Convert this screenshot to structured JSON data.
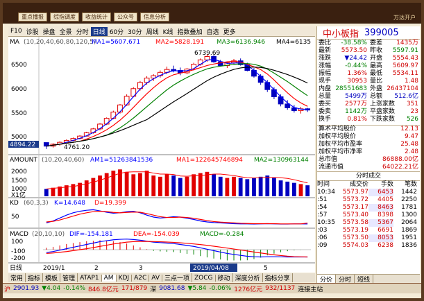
{
  "topbar": {
    "tabs": [
      "重点播报",
      "综指调度",
      "收益统计",
      "公众号",
      "信息分析"
    ],
    "right_text": "万达开户"
  },
  "toolbar": {
    "items": [
      "F10",
      "诊股",
      "操盘",
      "全景",
      "分时",
      "日线",
      "60分",
      "30分",
      "周线",
      "K线",
      "指数叠加",
      "自选",
      "更多"
    ],
    "selected": "日线"
  },
  "ma_legend": {
    "label": "MA",
    "params": "(10,20,40,60,80,120,5)",
    "ma1": "MA1=5607.671",
    "ma2": "MA2=5828.191",
    "ma3": "MA3=6136.946",
    "ma4": "MA4=6135"
  },
  "price_axis": [
    "6500",
    "6000",
    "5500",
    "5000"
  ],
  "price_labels": {
    "high": "6739.69",
    "low": "4761.20",
    "cur": "4894.22"
  },
  "amount_legend": {
    "label": "AMOUNT",
    "params": "(10,20,40,60)",
    "am1": "AM1=51263841536",
    "ma1": "MA1=122645746894",
    "ma2": "MA2=130963144"
  },
  "amount_axis": [
    "2000",
    "1500",
    "1000",
    "500"
  ],
  "amount_unit": "X1亿",
  "kd_legend": {
    "label": "KD",
    "params": "(60,3,3)",
    "k": "K=14.648",
    "d": "D=19.399"
  },
  "kd_axis": [
    "50"
  ],
  "macd_legend": {
    "label": "MACD",
    "params": "(20,10,10)",
    "dif": "DIF=-154.181",
    "dea": "DEA=-154.039",
    "macd": "MACD=-0.284"
  },
  "macd_axis": [
    "100",
    "-100",
    "-200"
  ],
  "date_axis": {
    "unit": "日线",
    "labels": [
      "2019/1",
      "2",
      "3",
      "2019/04/08",
      "5"
    ]
  },
  "bottom_tabs": [
    "常用",
    "指标",
    "模板",
    "管理",
    "ATAP1",
    "AM",
    "KDJ",
    "A2C",
    "AV",
    "三点一项",
    "ZOCG",
    "移动",
    "深度分析",
    "指标分享"
  ],
  "bottom_tab_selected": "AM",
  "status": {
    "items": [
      {
        "t": "沪",
        "c": "red"
      },
      {
        "t": "2901.93",
        "c": "blue"
      },
      {
        "t": "▼4.04",
        "c": "green"
      },
      {
        "t": "-0.14%",
        "c": "green"
      },
      {
        "t": "846.8亿元",
        "c": "red"
      },
      {
        "t": "171/879",
        "c": "red"
      },
      {
        "t": "深",
        "c": ""
      },
      {
        "t": "9081.68",
        "c": "blue"
      },
      {
        "t": "▼5.84",
        "c": "green"
      },
      {
        "t": "-0.06%",
        "c": "green"
      },
      {
        "t": "1276亿元",
        "c": "red"
      },
      {
        "t": "932/1137",
        "c": "red"
      },
      {
        "t": "连接主站",
        "c": ""
      }
    ]
  },
  "quote": {
    "name": "中小板指",
    "code": "399005",
    "rows": [
      [
        [
          "委比",
          "-38.58%",
          "green"
        ],
        [
          "委差",
          "1435万",
          "red"
        ]
      ],
      [
        [
          "最新",
          "5573.50",
          "red"
        ],
        [
          "昨收",
          "5597.91",
          "green"
        ]
      ],
      [
        [
          "涨跌",
          "▼24.42",
          "blue"
        ],
        [
          "开盘",
          "5554.43",
          "red"
        ]
      ],
      [
        [
          "涨幅",
          "-0.44%",
          "green"
        ],
        [
          "最高",
          "5609.97",
          "red"
        ]
      ],
      [
        [
          "振幅",
          "1.36%",
          "red"
        ],
        [
          "最低",
          "5534.11",
          "red"
        ]
      ],
      [
        [
          "现手",
          "30953",
          "red"
        ],
        [
          "量比",
          "1.48",
          "red"
        ]
      ],
      [
        [
          "内盘",
          "28551683",
          "green"
        ],
        [
          "外盘",
          "26437104",
          "red"
        ]
      ],
      [
        [
          "总量",
          "5499万",
          "blue"
        ],
        [
          "总额",
          "512.6亿",
          "blue"
        ]
      ],
      [
        [
          "委买",
          "2577万",
          "red"
        ],
        [
          "上涨家数",
          "351",
          "red"
        ]
      ],
      [
        [
          "委卖",
          "1142万",
          "green"
        ],
        [
          "平盘家数",
          "23",
          "red"
        ]
      ],
      [
        [
          "换手",
          "0.81%",
          "red"
        ],
        [
          "下跌家数",
          "526",
          "green"
        ]
      ]
    ],
    "stats": [
      [
        "算术平均股价",
        "12.13"
      ],
      [
        "加权平均股价",
        "9.47"
      ],
      [
        "加权平均市盈率",
        "25.48"
      ],
      [
        "加权平均市净率",
        "2.48"
      ],
      [
        "总市值",
        "86888.00亿"
      ],
      [
        "流通市值",
        "64022.21亿"
      ]
    ]
  },
  "trades": {
    "header": [
      "时间",
      "成交价",
      "手数",
      "笔数"
    ],
    "section_title": "分时成交",
    "rows": [
      [
        "10:34",
        "5573.97",
        "6453",
        "1442"
      ],
      [
        ":51",
        "5573.72",
        "4405",
        "2250"
      ],
      [
        ":54",
        "5573.17",
        "8463",
        "1781"
      ],
      [
        ":57",
        "5573.40",
        "8398",
        "1300"
      ],
      [
        "10:35",
        "5573.58",
        "5367",
        "2064"
      ],
      [
        ":03",
        "5573.19",
        "6691",
        "1869"
      ],
      [
        ":06",
        "5573.50",
        "8053",
        "1951"
      ],
      [
        ":09",
        "5574.03",
        "6238",
        "1836"
      ]
    ]
  },
  "rp_tabs": [
    "分价",
    "分时",
    "短线"
  ],
  "rp_tab_selected": "分价",
  "chart_data": {
    "type": "line",
    "candles_ohlc": [
      [
        4894,
        4894,
        4761,
        4820
      ],
      [
        4820,
        4880,
        4790,
        4860
      ],
      [
        4860,
        4920,
        4830,
        4900
      ],
      [
        4900,
        4960,
        4880,
        4940
      ],
      [
        4940,
        5000,
        4920,
        4980
      ],
      [
        4980,
        5050,
        4960,
        5030
      ],
      [
        5030,
        5120,
        5020,
        5100
      ],
      [
        5100,
        5200,
        5080,
        5180
      ],
      [
        5180,
        5300,
        5150,
        5280
      ],
      [
        5280,
        5420,
        5260,
        5400
      ],
      [
        5400,
        5560,
        5380,
        5530
      ],
      [
        5530,
        5700,
        5500,
        5680
      ],
      [
        5680,
        5900,
        5660,
        5860
      ],
      [
        5860,
        6050,
        5840,
        6020
      ],
      [
        6020,
        6180,
        5980,
        6150
      ],
      [
        6150,
        6280,
        6100,
        6240
      ],
      [
        6240,
        6320,
        6180,
        6290
      ],
      [
        6290,
        6400,
        6250,
        6360
      ],
      [
        6360,
        6480,
        6320,
        6420
      ],
      [
        6420,
        6500,
        6360,
        6400
      ],
      [
        6400,
        6460,
        6300,
        6350
      ],
      [
        6350,
        6450,
        6320,
        6430
      ],
      [
        6430,
        6560,
        6400,
        6530
      ],
      [
        6530,
        6650,
        6500,
        6620
      ],
      [
        6620,
        6739,
        6580,
        6690
      ],
      [
        6690,
        6720,
        6560,
        6580
      ],
      [
        6580,
        6620,
        6480,
        6500
      ],
      [
        6500,
        6580,
        6450,
        6560
      ],
      [
        6560,
        6640,
        6520,
        6600
      ],
      [
        6600,
        6650,
        6500,
        6520
      ],
      [
        6520,
        6560,
        6380,
        6400
      ],
      [
        6400,
        6450,
        6250,
        6280
      ],
      [
        6280,
        6320,
        6100,
        6150
      ],
      [
        6150,
        6200,
        5950,
        6000
      ],
      [
        6000,
        6050,
        5800,
        5850
      ],
      [
        5850,
        5900,
        5650,
        5700
      ],
      [
        5700,
        5780,
        5580,
        5620
      ],
      [
        5620,
        5680,
        5520,
        5560
      ],
      [
        5560,
        5640,
        5500,
        5600
      ],
      [
        5600,
        5620,
        5534,
        5573
      ]
    ],
    "ylim": [
      4700,
      6900
    ],
    "amount_ylim": [
      0,
      2500
    ],
    "amount_values": [
      600,
      700,
      800,
      900,
      1000,
      1100,
      1300,
      1500,
      1700,
      1900,
      2100,
      2200,
      2000,
      1800,
      1900,
      2100,
      1700,
      1600,
      1800,
      1700,
      1500,
      1600,
      1800,
      1900,
      2000,
      1800,
      1600,
      1500,
      1600,
      1500,
      1400,
      1500,
      1600,
      1700,
      1500,
      1300,
      1200,
      1100,
      1000,
      900
    ],
    "macd_dif": [
      -60,
      -40,
      -10,
      20,
      50,
      80,
      110,
      140,
      170,
      190,
      210,
      220,
      225,
      215,
      200,
      180,
      160,
      150,
      140,
      130,
      110,
      90,
      70,
      40,
      10,
      -20,
      -50,
      -80,
      -100,
      -120,
      -140,
      -150,
      -154,
      -150,
      -150,
      -152,
      -154,
      -154,
      -154,
      -154
    ],
    "macd_dea": [
      -80,
      -70,
      -55,
      -40,
      -20,
      0,
      20,
      45,
      70,
      95,
      120,
      140,
      160,
      170,
      175,
      175,
      172,
      168,
      162,
      155,
      145,
      135,
      122,
      108,
      92,
      74,
      54,
      34,
      14,
      -6,
      -28,
      -50,
      -70,
      -90,
      -108,
      -124,
      -138,
      -148,
      -152,
      -154
    ],
    "kd_k": [
      20,
      30,
      45,
      60,
      72,
      80,
      85,
      88,
      82,
      75,
      70,
      72,
      78,
      80,
      72,
      60,
      50,
      45,
      48,
      52,
      50,
      44,
      38,
      30,
      25,
      22,
      20,
      18,
      16,
      15,
      15,
      14,
      15,
      16,
      15,
      14,
      14,
      15,
      15,
      14.6
    ],
    "kd_d": [
      25,
      28,
      35,
      45,
      55,
      65,
      72,
      78,
      80,
      78,
      74,
      72,
      74,
      76,
      75,
      68,
      60,
      52,
      48,
      48,
      50,
      48,
      44,
      38,
      32,
      27,
      24,
      22,
      20,
      18,
      17,
      16,
      16,
      16,
      16,
      15,
      15,
      15,
      15,
      19.4
    ]
  }
}
